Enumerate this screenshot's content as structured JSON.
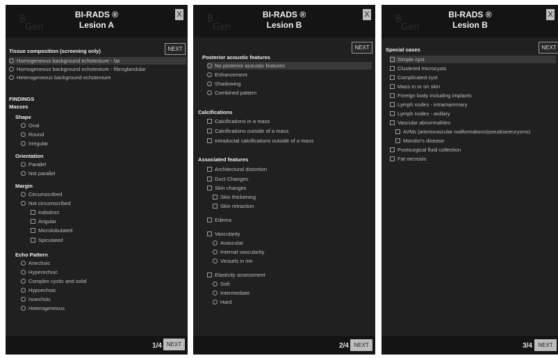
{
  "panels": [
    {
      "app_title": "BI-RADS ®",
      "subtitle": "Lesion A",
      "logo": [
        "B",
        "Gen"
      ],
      "close_label": "X",
      "pager": "1/4",
      "next_bottom": "NEXT",
      "next_top": "NEXT",
      "sections": {
        "tissue": {
          "title": "Tissue composition (screening only)",
          "options": [
            "Homogeneous background echotexture - fat",
            "Homogeneous background echotexture - fibroglandular",
            "Heterogeneous background echotexture"
          ]
        },
        "findings": "FINDINGS",
        "masses": "Masses",
        "shape": {
          "title": "Shape",
          "options": [
            "Oval",
            "Round",
            "Irregular"
          ]
        },
        "orientation": {
          "title": "Orientation",
          "options": [
            "Parallel",
            "Not parallel"
          ]
        },
        "margin": {
          "title": "Margin",
          "options": [
            "Circumscribed",
            "Not circumscribed"
          ],
          "sub": [
            "Indistinct",
            "Angular",
            "Microlobulated",
            "Spiculated"
          ]
        },
        "echo": {
          "title": "Echo Pattern",
          "options": [
            "Anechoic",
            "Hyperechoic",
            "Complex cystic and solid",
            "Hypoechoic",
            "Isoechoic",
            "Heterogeneous"
          ]
        }
      }
    },
    {
      "app_title": "BI-RADS ®",
      "subtitle": "Lesion B",
      "logo": [
        "B",
        "Gen"
      ],
      "close_label": "X",
      "pager": "2/4",
      "next_bottom": "NEXT",
      "next_top": "NEXT",
      "sections": {
        "posterior": {
          "title": "Posterior acoustic features",
          "options": [
            "No posterior acoustic features",
            "Enhancement",
            "Shadowing",
            "Combined pattern"
          ]
        },
        "calcifications": {
          "title": "Calcifications",
          "options": [
            "Calcifications in a mass",
            "Calcifications outside of a mass",
            "Intraductal calcifications outside of a mass"
          ]
        },
        "associated": {
          "title": "Associated features",
          "items": [
            "Architectural distortion",
            "Duct Changes",
            "Skin changes"
          ],
          "skin_sub": [
            "Skin thickening",
            "Skin retraction"
          ],
          "edema": "Edema",
          "vascularity": "Vascularity",
          "vascularity_sub": [
            "Avascular",
            "Internal vascularity",
            "Vessels in rim"
          ],
          "elasticity": "Elasticity assessment",
          "elasticity_sub": [
            "Soft",
            "Intermediate",
            "Hard"
          ]
        }
      }
    },
    {
      "app_title": "BI-RADS ®",
      "subtitle": "Lesion B",
      "logo": [
        "B",
        "Gen"
      ],
      "close_label": "X",
      "pager": "3/4",
      "next_bottom": "NEXT",
      "next_top": "NEXT",
      "sections": {
        "special": {
          "title": "Special cases",
          "items": [
            "Simple cyst",
            "Clustered microcysts",
            "Complicated cyst",
            "Mass in or on skin",
            "Foreign body including implants",
            "Lymph nodes - intramammary",
            "Lymph nodes - axillary",
            "Vascular abnormalities"
          ],
          "vascular_sub": [
            "AVMs (arteriovascular malformations/pseudoaneurysms)",
            "Mondor's disease"
          ],
          "after": [
            "Postsurgical fluid collection",
            "Fat necrosis"
          ]
        }
      }
    }
  ]
}
